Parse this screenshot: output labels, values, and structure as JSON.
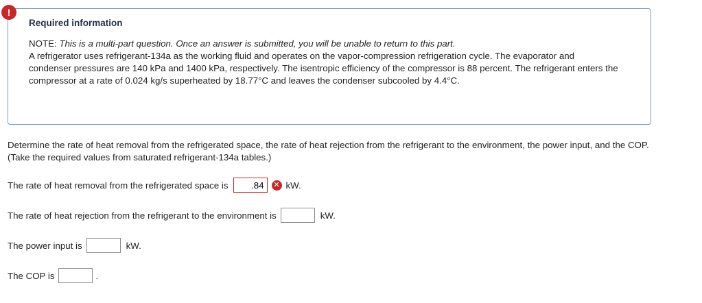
{
  "alert": {
    "icon": "exclamation-icon",
    "symbol": "!"
  },
  "info": {
    "title": "Required information",
    "note_label": "NOTE:",
    "note_text": "This is a multi-part question. Once an answer is submitted, you will be unable to return to this part.",
    "body": "A refrigerator uses refrigerant-134a as the working fluid and operates on the vapor-compression refrigeration cycle. The evaporator and condenser pressures are 140 kPa and 1400 kPa, respectively. The isentropic efficiency of the compressor is 88 percent. The refrigerant enters the compressor at a rate of 0.024 kg/s superheated by 18.77°C and leaves the condenser subcooled by 4.4°C."
  },
  "question": "Determine the rate of heat removal from the refrigerated space, the rate of heat rejection from the refrigerant to the environment, the power input, and the COP. (Take the required values from saturated refrigerant-134a tables.)",
  "answers": {
    "heat_removal": {
      "label": "The rate of heat removal from the refrigerated space is",
      "value": ".84",
      "unit": "kW.",
      "status_icon": "x-circle-icon",
      "status_symbol": "✕"
    },
    "heat_rejection": {
      "label": "The rate of heat rejection from the refrigerant to the environment is",
      "value": "",
      "unit": "kW."
    },
    "power_input": {
      "label": "The power input is",
      "value": "",
      "unit": "kW."
    },
    "cop": {
      "label": "The COP is",
      "value": "",
      "unit": "."
    }
  },
  "colors": {
    "error": "#c62828",
    "box_border": "#7a9cc0",
    "title": "#1f2f4a"
  }
}
